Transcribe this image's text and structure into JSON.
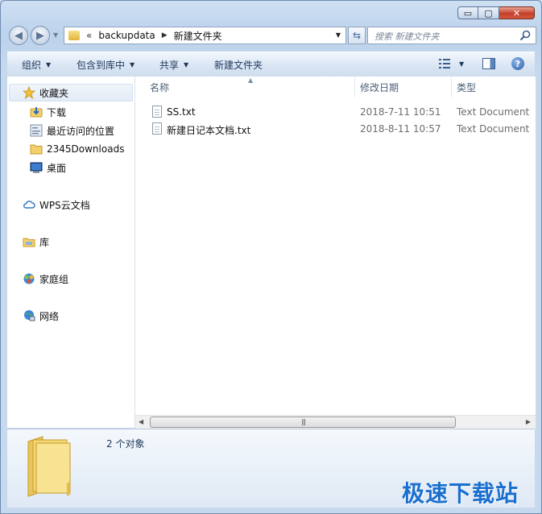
{
  "window": {
    "caption_buttons": {
      "minimize": "▭",
      "maximize": "▢",
      "close": "✕"
    }
  },
  "nav": {
    "address": {
      "overflow": "«",
      "crumbs": [
        "backupdata",
        "新建文件夹"
      ]
    },
    "search": {
      "placeholder": "搜索 新建文件夹"
    }
  },
  "toolbar": {
    "organize": "组织",
    "include_in_library": "包含到库中",
    "share": "共享",
    "new_folder": "新建文件夹"
  },
  "sidebar": {
    "favorites": "收藏夹",
    "favorites_items": [
      "下载",
      "最近访问的位置",
      "2345Downloads",
      "桌面"
    ],
    "wps_cloud": "WPS云文档",
    "libraries": "库",
    "homegroup": "家庭组",
    "network": "网络"
  },
  "columns": {
    "name": "名称",
    "modified": "修改日期",
    "type": "类型"
  },
  "files": [
    {
      "name": "SS.txt",
      "modified": "2018-7-11 10:51",
      "type": "Text Document"
    },
    {
      "name": "新建日记本文档.txt",
      "modified": "2018-8-11 10:57",
      "type": "Text Document"
    }
  ],
  "details": {
    "item_count": "2 个对象"
  },
  "watermark": "极速下载站",
  "colors": {
    "accent": "#1b6fcf",
    "window_frame": "#c9dcf0",
    "close_button": "#c5402a"
  }
}
